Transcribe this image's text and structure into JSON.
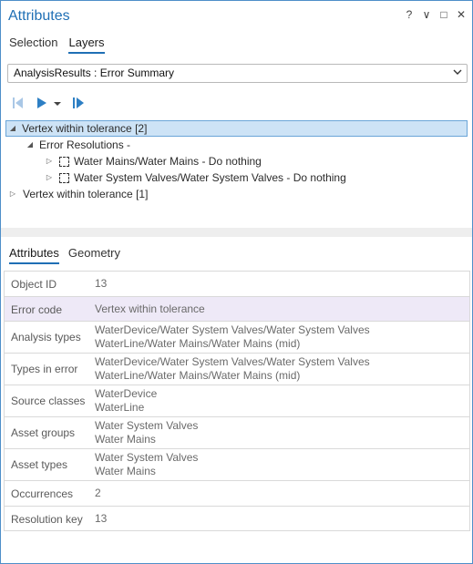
{
  "window": {
    "title": "Attributes",
    "controls": {
      "help": "?",
      "menu": "∨",
      "maximize": "□",
      "close": "✕"
    }
  },
  "top_tabs": [
    {
      "label": "Selection",
      "active": false
    },
    {
      "label": "Layers",
      "active": true
    }
  ],
  "layer_select": {
    "value": "AnalysisResults : Error Summary"
  },
  "tree": {
    "node1": {
      "label": "Vertex within tolerance [2]"
    },
    "node1_child": {
      "label": "Error Resolutions -"
    },
    "res1": {
      "label": "Water Mains/Water Mains - Do nothing"
    },
    "res2": {
      "label": "Water System Valves/Water System Valves - Do nothing"
    },
    "node2": {
      "label": "Vertex within tolerance [1]"
    }
  },
  "bottom_tabs": [
    {
      "label": "Attributes",
      "active": true
    },
    {
      "label": "Geometry",
      "active": false
    }
  ],
  "attributes": {
    "object_id": {
      "name": "Object ID",
      "values": [
        "13"
      ]
    },
    "error_code": {
      "name": "Error code",
      "values": [
        "Vertex within tolerance"
      ]
    },
    "analysis_types": {
      "name": "Analysis types",
      "values": [
        "WaterDevice/Water System Valves/Water System Valves",
        "WaterLine/Water Mains/Water Mains (mid)"
      ]
    },
    "types_in_error": {
      "name": "Types in error",
      "values": [
        "WaterDevice/Water System Valves/Water System Valves",
        "WaterLine/Water Mains/Water Mains (mid)"
      ]
    },
    "source_classes": {
      "name": "Source classes",
      "values": [
        "WaterDevice",
        "WaterLine"
      ]
    },
    "asset_groups": {
      "name": "Asset groups",
      "values": [
        "Water System Valves",
        "Water Mains"
      ]
    },
    "asset_types": {
      "name": "Asset types",
      "values": [
        "Water System Valves",
        "Water Mains"
      ]
    },
    "occurrences": {
      "name": "Occurrences",
      "values": [
        "2"
      ]
    },
    "resolution_key": {
      "name": "Resolution key",
      "values": [
        "13"
      ]
    }
  },
  "colors": {
    "accent": "#1f6fb5",
    "selection": "#cde3f6",
    "highlight_row": "#eee9f7"
  },
  "icons": [
    "previous-icon",
    "play-icon",
    "play-dropdown-icon",
    "last-icon",
    "expand-icon",
    "collapse-icon",
    "checkbox-icon",
    "chevron-down-icon"
  ]
}
